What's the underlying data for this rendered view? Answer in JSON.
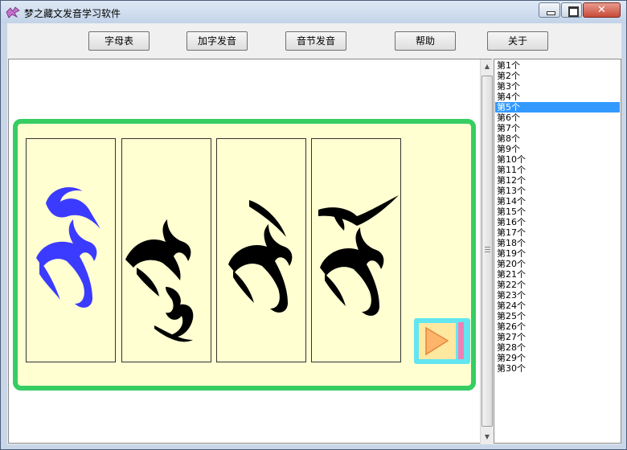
{
  "window": {
    "title": "梦之藏文发音学习软件"
  },
  "toolbar": {
    "alphabet_label": "字母表",
    "affix_label": "加字发音",
    "syllable_label": "音节发音",
    "help_label": "帮助",
    "about_label": "关于"
  },
  "syllables": [
    {
      "glyph_color": "#3b3bff",
      "state": "highlighted"
    },
    {
      "glyph_color": "#000000",
      "state": "normal"
    },
    {
      "glyph_color": "#000000",
      "state": "normal"
    },
    {
      "glyph_color": "#000000",
      "state": "normal"
    }
  ],
  "list": {
    "selected_index": 4,
    "items": [
      "第1个",
      "第2个",
      "第3个",
      "第4个",
      "第5个",
      "第6个",
      "第7个",
      "第8个",
      "第9个",
      "第10个",
      "第11个",
      "第12个",
      "第13个",
      "第14个",
      "第15个",
      "第16个",
      "第17个",
      "第18个",
      "第19个",
      "第20个",
      "第21个",
      "第22个",
      "第23个",
      "第24个",
      "第25个",
      "第26个",
      "第27个",
      "第28个",
      "第29个",
      "第30个"
    ]
  },
  "colors": {
    "panel_border": "#36cd63",
    "panel_fill": "#ffffd2",
    "highlight_glyph": "#3b3bff",
    "list_selection": "#3399ff"
  }
}
